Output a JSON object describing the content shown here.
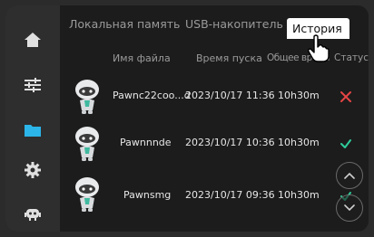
{
  "tabs": [
    {
      "label": "Локальная память"
    },
    {
      "label": "USB-накопитель"
    },
    {
      "label": "История"
    }
  ],
  "columns": {
    "name": "Имя файла",
    "start_time": "Время пуска",
    "total_time": "Общее время",
    "status": "Статус"
  },
  "rows": [
    {
      "name": "Pawnc22coo...d",
      "start_time": "2023/10/17 11:36",
      "total_time": "10h30m",
      "status": "failed"
    },
    {
      "name": "Pawnnnde",
      "start_time": "2023/10/17 10:36",
      "total_time": "10h30m",
      "status": "success"
    },
    {
      "name": "Pawnsmg",
      "start_time": "2023/10/17 09:36",
      "total_time": "10h30m",
      "status": "success"
    }
  ],
  "sidebar": [
    {
      "icon": "home-icon"
    },
    {
      "icon": "sliders-icon"
    },
    {
      "icon": "folder-icon",
      "active": true
    },
    {
      "icon": "gear-icon"
    },
    {
      "icon": "robot-icon"
    }
  ],
  "colors": {
    "accent": "#2bb5e8",
    "success": "#2ecc9a",
    "error": "#e64545"
  }
}
